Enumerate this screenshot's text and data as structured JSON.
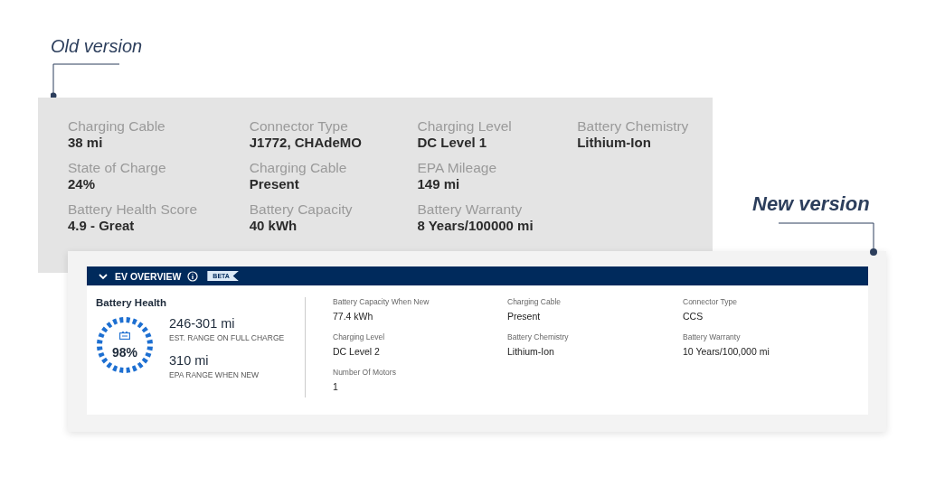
{
  "old_version": {
    "label": "Old version",
    "columns": [
      [
        {
          "label": "Charging Cable",
          "value": "38 mi"
        },
        {
          "label": "State of Charge",
          "value": "24%"
        },
        {
          "label": "Battery Health Score",
          "value": "4.9 - Great"
        }
      ],
      [
        {
          "label": "Connector Type",
          "value": "J1772, CHAdeMO"
        },
        {
          "label": "Charging Cable",
          "value": "Present"
        },
        {
          "label": "Battery Capacity",
          "value": "40 kWh"
        }
      ],
      [
        {
          "label": "Charging Level",
          "value": "DC Level 1"
        },
        {
          "label": "EPA Mileage",
          "value": "149 mi"
        },
        {
          "label": "Battery Warranty",
          "value": "8 Years/100000 mi"
        }
      ],
      [
        {
          "label": "Battery Chemistry",
          "value": "Lithium-Ion"
        }
      ]
    ]
  },
  "new_version": {
    "label": "New version",
    "panel": {
      "title": "EV OVERVIEW",
      "badge": "BETA",
      "expanded": true,
      "battery_health": {
        "title": "Battery Health",
        "score": "98%",
        "level": 0.98,
        "stats": [
          {
            "value": "246-301 mi",
            "caption": "EST. RANGE ON FULL CHARGE"
          },
          {
            "value": "310 mi",
            "caption": "EPA RANGE WHEN NEW"
          }
        ]
      },
      "columns": [
        [
          {
            "label": "Battery Capacity When New",
            "value": "77.4 kWh"
          },
          {
            "label": "Charging Level",
            "value": "DC Level 2"
          },
          {
            "label": "Number Of Motors",
            "value": "1"
          }
        ],
        [
          {
            "label": "Charging Cable",
            "value": "Present"
          },
          {
            "label": "Battery Chemistry",
            "value": "Lithium-Ion"
          }
        ],
        [
          {
            "label": "Connector Type",
            "value": "CCS"
          },
          {
            "label": "Battery Warranty",
            "value": "10 Years/100,000 mi"
          }
        ]
      ]
    }
  }
}
